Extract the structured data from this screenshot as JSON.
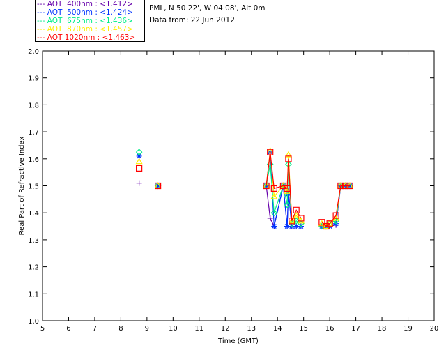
{
  "header": {
    "site": "PML, N 50 22', W 04 08', Alt 0m",
    "date": "Data from: 22 Jun 2012"
  },
  "chart_data": {
    "type": "line",
    "title": "",
    "xlabel": "Time (GMT)",
    "ylabel": "Real Part of Refractive Index",
    "xlim": [
      5,
      20
    ],
    "ylim": [
      1.0,
      2.0
    ],
    "xticks": [
      "5",
      "6",
      "7",
      "8",
      "9",
      "10",
      "11",
      "12",
      "13",
      "14",
      "15",
      "16",
      "17",
      "18",
      "19",
      "20"
    ],
    "yticks": [
      "1.0",
      "1.1",
      "1.2",
      "1.3",
      "1.4",
      "1.5",
      "1.6",
      "1.7",
      "1.8",
      "1.9",
      "2.0"
    ],
    "grid": false,
    "legend_placement": "top-left, outside",
    "x": [
      8.7,
      9.42,
      13.57,
      13.72,
      13.87,
      14.22,
      14.37,
      14.42,
      14.55,
      14.72,
      14.9,
      15.7,
      15.86,
      16.0,
      16.24,
      16.42,
      16.6,
      16.77
    ],
    "series": [
      {
        "name": "AOT  400nm : <1.412>",
        "color": "#6600aa",
        "marker": "plus",
        "values": [
          1.51,
          1.5,
          1.5,
          1.38,
          1.35,
          1.5,
          1.35,
          1.48,
          1.35,
          1.35,
          1.35,
          1.35,
          1.35,
          1.35,
          1.355,
          1.5,
          1.5,
          1.5
        ]
      },
      {
        "name": "AOT  500nm : <1.424>",
        "color": "#0033ff",
        "marker": "asterisk",
        "values": [
          1.61,
          1.5,
          1.5,
          1.625,
          1.35,
          1.5,
          1.35,
          1.47,
          1.35,
          1.35,
          1.35,
          1.35,
          1.35,
          1.35,
          1.36,
          1.5,
          1.5,
          1.5
        ]
      },
      {
        "name": "AOT  675nm : <1.436>",
        "color": "#00ee88",
        "marker": "diamond",
        "values": [
          1.625,
          1.5,
          1.5,
          1.58,
          1.4,
          1.5,
          1.43,
          1.58,
          1.36,
          1.37,
          1.36,
          1.35,
          1.35,
          1.36,
          1.37,
          1.5,
          1.5,
          1.5
        ]
      },
      {
        "name": "AOT  870nm : <1.457>",
        "color": "#ffee00",
        "marker": "triangle",
        "values": [
          1.59,
          1.5,
          1.5,
          1.63,
          1.46,
          1.5,
          1.48,
          1.615,
          1.37,
          1.39,
          1.37,
          1.36,
          1.35,
          1.36,
          1.38,
          1.5,
          1.5,
          1.5
        ]
      },
      {
        "name": "AOT 1020nm : <1.463>",
        "color": "#ff0000",
        "marker": "square",
        "values": [
          1.565,
          1.5,
          1.5,
          1.625,
          1.49,
          1.5,
          1.49,
          1.6,
          1.37,
          1.41,
          1.38,
          1.365,
          1.35,
          1.36,
          1.39,
          1.5,
          1.5,
          1.5
        ]
      }
    ]
  }
}
